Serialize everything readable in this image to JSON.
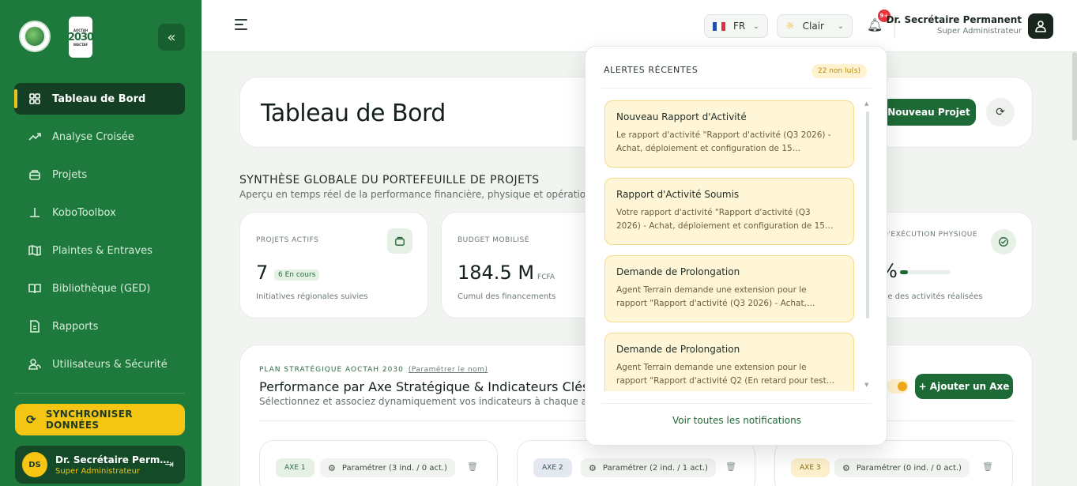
{
  "sidebar": {
    "logo2_text": "2030",
    "logo2_top": "AOCTAH",
    "logo2_bottom": "WACTAF",
    "collapse_icon": "«",
    "items": [
      {
        "label": "Tableau de Bord",
        "icon": "grid-icon",
        "active": true
      },
      {
        "label": "Analyse Croisée",
        "icon": "trend-icon"
      },
      {
        "label": "Projets",
        "icon": "briefcase-icon"
      },
      {
        "label": "KoboToolbox",
        "icon": "anchor-icon"
      },
      {
        "label": "Plaintes & Entraves",
        "icon": "map-icon"
      },
      {
        "label": "Bibliothèque (GED)",
        "icon": "book-icon"
      },
      {
        "label": "Rapports",
        "icon": "report-icon"
      },
      {
        "label": "Utilisateurs & Sécurité",
        "icon": "users-icon"
      }
    ],
    "sync_label": "SYNCHRONISER DONNÉES",
    "user": {
      "initials": "DS",
      "name": "Dr. Secrétaire Perm…",
      "role": "Super Administrateur"
    }
  },
  "topbar": {
    "lang": "FR",
    "theme": "Clair",
    "notif_badge": "9+",
    "user_name": "Dr. Secrétaire Permanent",
    "user_role": "Super Administrateur"
  },
  "hero": {
    "title": "Tableau de Bord",
    "new_project": "Nouveau Projet"
  },
  "synthese": {
    "title": "SYNTHÈSE GLOBALE DU PORTEFEUILLE DE PROJETS",
    "subtitle": "Aperçu en temps réel de la performance financière, physique et opératio"
  },
  "kpis": {
    "projets": {
      "label": "PROJETS ACTIFS",
      "value": "7",
      "tag": "6 En cours",
      "desc": "Initiatives régionales suivies"
    },
    "budget": {
      "label": "BUDGET MOBILISÉ",
      "value": "184.5 M",
      "unit": "FCFA",
      "desc": "Cumul des financements"
    },
    "physique": {
      "label": "D'EXÉCUTION PHYSIQUE",
      "value": "%",
      "desc": "ne des activités réalisées"
    }
  },
  "plan": {
    "kicker": "PLAN STRATÉGIQUE AOCTAH 2030",
    "kicker_link": "(Paramétrer le nom)",
    "title": "Performance par Axe Stratégique & Indicateurs Clés",
    "subtitle": "Sélectionnez et associez dynamiquement vos indicateurs à chaque a",
    "add_axe": "+ Ajouter un Axe"
  },
  "axes": [
    {
      "tag": "AXE 1",
      "param": "Paramétrer (3 ind. / 0 act.)",
      "bg": "#e6f1e6",
      "fg": "#2d6a3f"
    },
    {
      "tag": "AXE 2",
      "param": "Paramétrer (2 ind. / 1 act.)",
      "bg": "#e3e9ee",
      "fg": "#3b4f5e"
    },
    {
      "tag": "AXE 3",
      "param": "Paramétrer (0 ind. / 0 act.)",
      "bg": "#fdf1cc",
      "fg": "#8a6a10"
    }
  ],
  "notifications": {
    "header": "ALERTES RÉCENTES",
    "unread": "22 non lu(s)",
    "items": [
      {
        "title": "Nouveau Rapport d'Activité",
        "desc1": "Le rapport d'activité \"Rapport d'activité (Q3 2026) -",
        "desc2": "Achat, déploiement et configuration de 15…"
      },
      {
        "title": "Rapport d'Activité Soumis",
        "desc1": "Votre rapport d'activité \"Rapport d'activité (Q3",
        "desc2": "2026) - Achat, déploiement et configuration de 15…"
      },
      {
        "title": "Demande de Prolongation",
        "desc1": "Agent Terrain demande une extension pour le",
        "desc2": "rapport \"Rapport d'activité (Q3 2026) - Achat,…"
      },
      {
        "title": "Demande de Prolongation",
        "desc1": "Agent Terrain demande une extension pour le",
        "desc2": "rapport \"Rapport d'activité Q2 (En retard pour test…"
      }
    ],
    "footer": "Voir toutes les notifications"
  }
}
